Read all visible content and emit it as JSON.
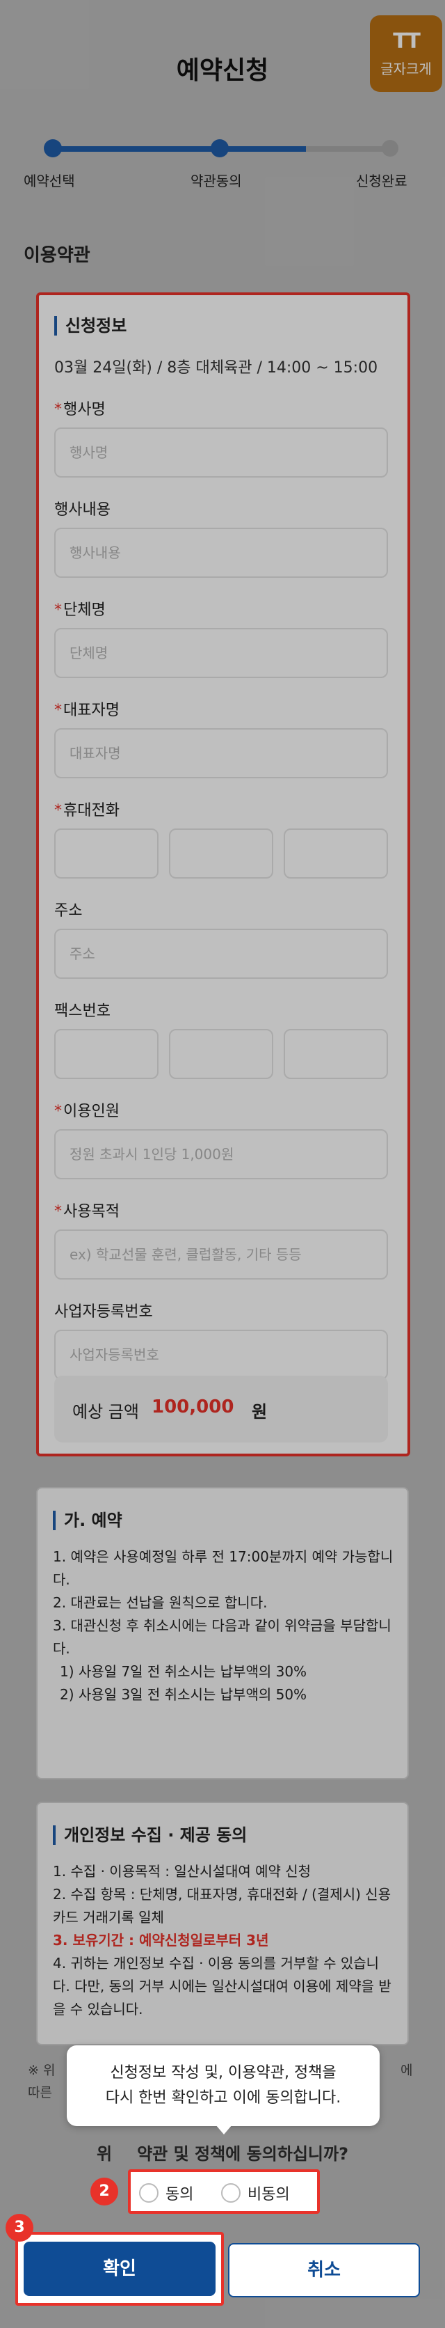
{
  "header": {
    "title": "예약신청",
    "font_size_button": {
      "glyph": "TT",
      "label": "글자크게"
    }
  },
  "stepper": {
    "steps": [
      {
        "label": "예약선택",
        "state": "done"
      },
      {
        "label": "약관동의",
        "state": "current"
      },
      {
        "label": "신청완료",
        "state": "pending"
      }
    ],
    "colors": {
      "active": "#1f5ca8",
      "inactive": "#a9a9a9"
    }
  },
  "section_label": "이용약관",
  "form": {
    "title": "신청정보",
    "info": "03월 24일(화) / 8층 대체육관 / 14:00 ~ 15:00",
    "fields": [
      {
        "label": "행사명",
        "required": true,
        "placeholder": "행사명"
      },
      {
        "label": "행사내용",
        "required": false,
        "placeholder": "행사내용"
      },
      {
        "label": "단체명",
        "required": true,
        "placeholder": "단체명"
      },
      {
        "label": "대표자명",
        "required": true,
        "placeholder": "대표자명"
      },
      {
        "label": "휴대전화",
        "required": true,
        "placeholder": ""
      },
      {
        "label": "주소",
        "required": false,
        "placeholder": "주소"
      },
      {
        "label": "팩스번호",
        "required": false,
        "placeholder": ""
      },
      {
        "label": "이용인원",
        "required": true,
        "placeholder": "정원 초과시 1인당 1,000원"
      },
      {
        "label": "사용목적",
        "required": true,
        "placeholder": "ex) 학교선물 훈련, 클럽활동, 기타 등등"
      },
      {
        "label": "사업자등록번호",
        "required": false,
        "placeholder": "사업자등록번호"
      }
    ],
    "fee": {
      "label": "예상 금액",
      "amount": "100,000",
      "unit": "원"
    }
  },
  "terms": {
    "title": "가. 예약",
    "lines": [
      "1. 예약은 사용예정일 하루 전 17:00분까지 예약 가능합니다.",
      "2. 대관료는 선납을 원칙으로 합니다.",
      "3. 대관신청 후 취소시에는 다음과 같이 위약금을 부담합니다.",
      "1) 사용일 7일 전 취소시는 납부액의 30%",
      "2) 사용일 3일 전 취소시는 납부액의 50%"
    ]
  },
  "privacy": {
    "title": "개인정보 수집 · 제공 동의",
    "lines": [
      "1. 수집 · 이용목적 : 일산시설대여 예약 신청",
      "2. 수집 항목 : 단체명, 대표자명, 휴대전화 / (결제시) 신용카드 거래기록 일체"
    ],
    "highlight": "3. 보유기간 : 예약신청일로부터 3년",
    "tail": "4. 귀하는 개인정보 수집 · 이용 동의를 거부할 수 있습니다. 다만, 동의 거부 시에는 일산시설대여 이용에 제약을 받을 수 있습니다."
  },
  "notice": {
    "left": "※ 위",
    "left2": "따른",
    "right": "에"
  },
  "tooltip": {
    "line1": "신청정보 작성 및, 이용약관, 정책을",
    "line2": "다시 한번 확인하고 이에 동의합니다."
  },
  "consent": {
    "question_prefix": "위",
    "question": "약관 및 정책에 동의하십니까?",
    "agree": "동의",
    "disagree": "비동의"
  },
  "badges": {
    "consent": "2",
    "confirm": "3"
  },
  "buttons": {
    "confirm": "확인",
    "cancel": "취소"
  }
}
